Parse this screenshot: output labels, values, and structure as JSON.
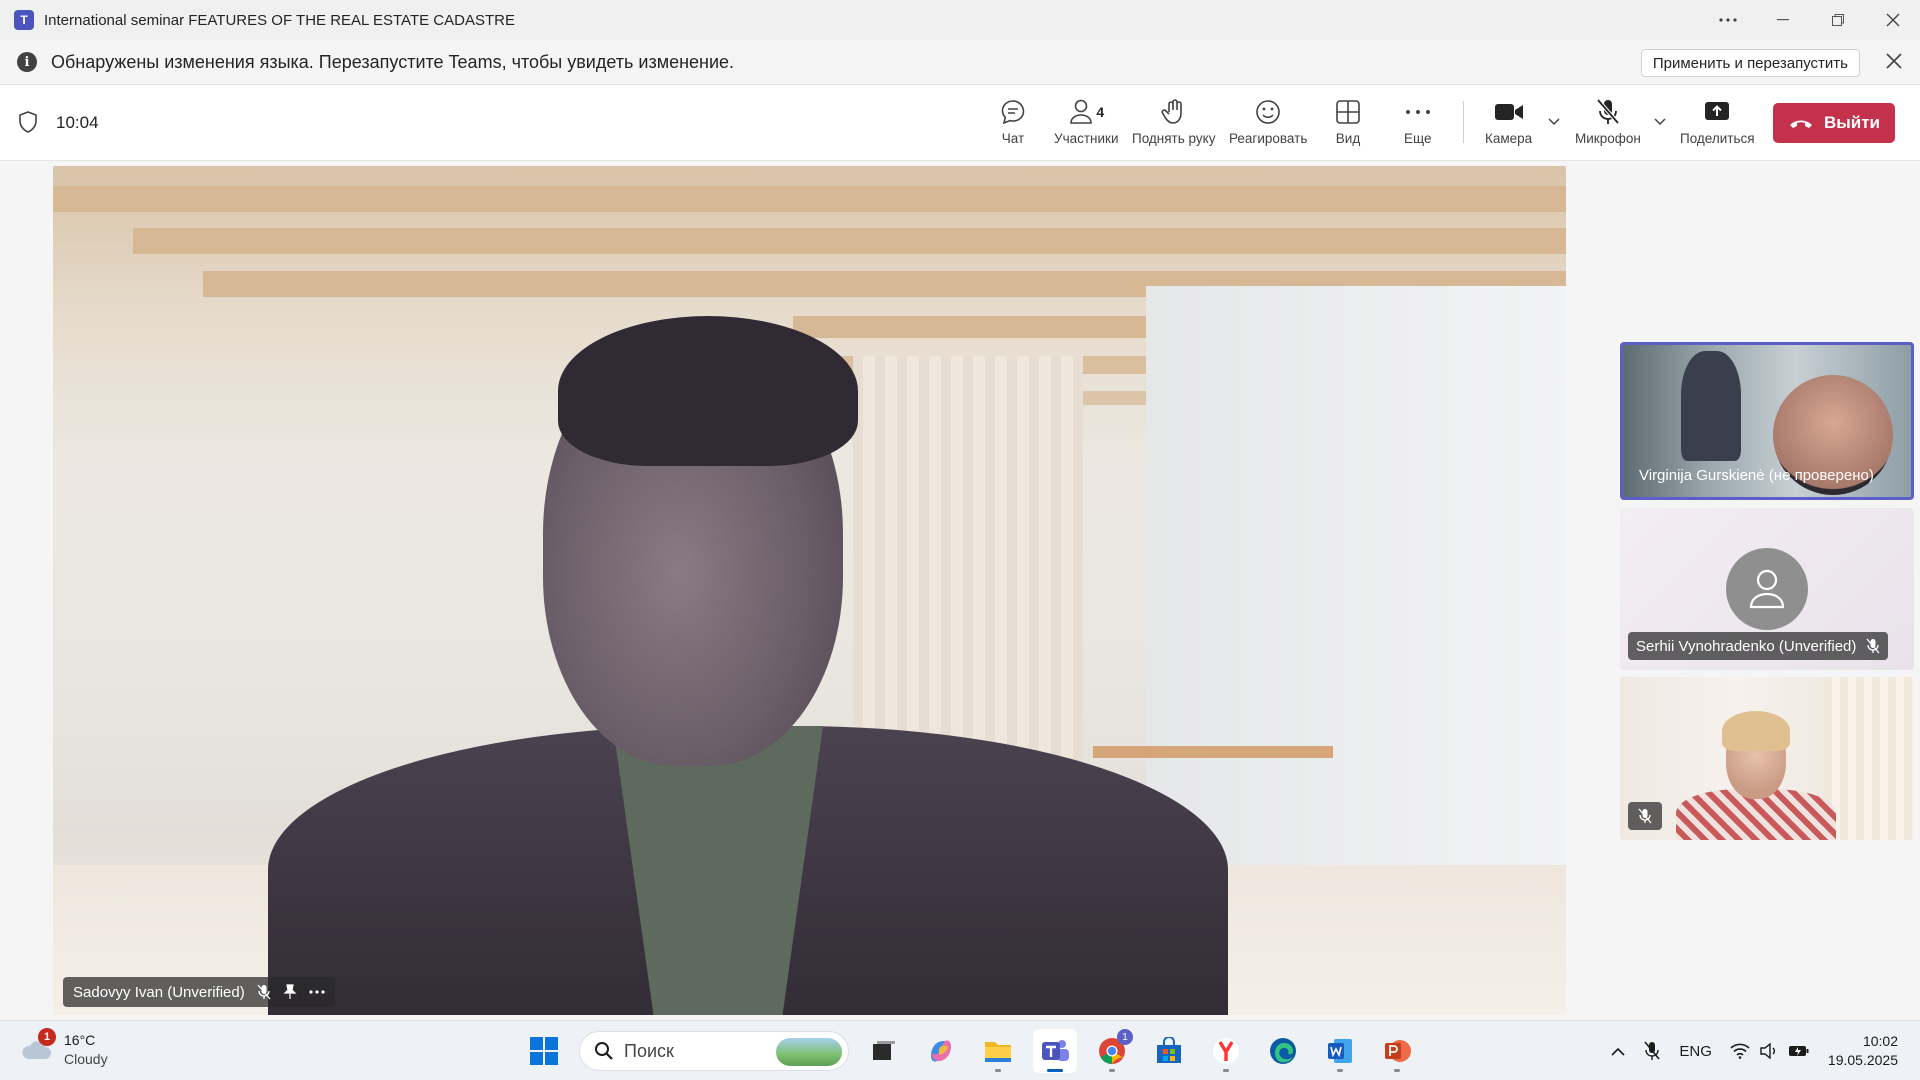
{
  "window": {
    "title": "International seminar FEATURES OF THE REAL ESTATE CADASTRE",
    "app_icon": "teams-logo"
  },
  "notification": {
    "text": "Обнаружены изменения языка. Перезапустите Teams, чтобы увидеть изменение.",
    "apply_label": "Применить и перезапустить"
  },
  "meeting": {
    "timer": "10:04",
    "toolbar": {
      "chat": "Чат",
      "participants": "Участники",
      "participants_count": "4",
      "raise_hand": "Поднять руку",
      "react": "Реагировать",
      "view": "Вид",
      "more": "Еще",
      "camera": "Камера",
      "mic": "Микрофон",
      "share": "Поделиться",
      "leave": "Выйти"
    },
    "leave_color": "#c4314b",
    "accent_color": "#5b5fc7"
  },
  "main_video": {
    "name": "Sadovyy Ivan (Unverified)"
  },
  "tiles": [
    {
      "name": "Virginija Gurskienė (не проверено)",
      "active_speaker": true
    },
    {
      "name": "Serhii Vynohradenko (Unverified)",
      "muted": true
    },
    {
      "name": "",
      "muted": true
    }
  ],
  "taskbar": {
    "weather_temp": "16°C",
    "weather_cond": "Cloudy",
    "weather_badge": "1",
    "search_placeholder": "Поиск",
    "lang": "ENG",
    "time": "10:02",
    "date": "19.05.2025",
    "chrome_badge": "1"
  }
}
